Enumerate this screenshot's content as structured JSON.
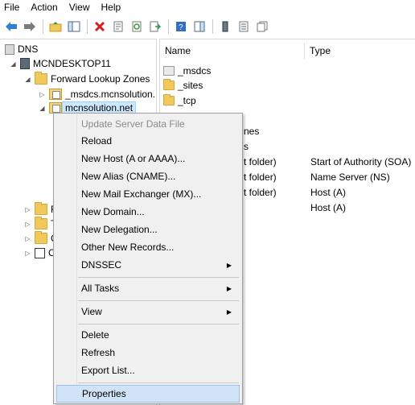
{
  "menubar": [
    "File",
    "Action",
    "View",
    "Help"
  ],
  "tree": {
    "root": "DNS",
    "server": "MCNDESKTOP11",
    "forward_zones": "Forward Lookup Zones",
    "zone1": "_msdcs.mcnsolution.",
    "zone2": "mcnsolution.net",
    "partial": [
      "R",
      "T",
      "C",
      "C"
    ]
  },
  "list": {
    "col_name": "Name",
    "col_type": "Type",
    "rows": [
      {
        "name": "_msdcs",
        "type": ""
      },
      {
        "name": "_sites",
        "type": ""
      },
      {
        "name": "_tcp",
        "type": ""
      },
      {
        "name": "nes",
        "type": ""
      },
      {
        "name": "s",
        "type": ""
      },
      {
        "name": "t folder)",
        "type": "Start of Authority (SOA)"
      },
      {
        "name": "t folder)",
        "type": "Name Server (NS)"
      },
      {
        "name": "t folder)",
        "type": "Host (A)"
      },
      {
        "name": "",
        "type": "Host (A)"
      }
    ]
  },
  "context_menu": {
    "update": "Update Server Data File",
    "reload": "Reload",
    "new_host": "New Host (A or AAAA)...",
    "new_alias": "New Alias (CNAME)...",
    "new_mx": "New Mail Exchanger (MX)...",
    "new_domain": "New Domain...",
    "new_delegation": "New Delegation...",
    "other_records": "Other New Records...",
    "dnssec": "DNSSEC",
    "all_tasks": "All Tasks",
    "view": "View",
    "delete": "Delete",
    "refresh": "Refresh",
    "export": "Export List...",
    "properties": "Properties"
  },
  "colors": {
    "selection": "#cce8ff",
    "menu_hover": "#d1e3f6",
    "folder": "#f1c95b"
  }
}
